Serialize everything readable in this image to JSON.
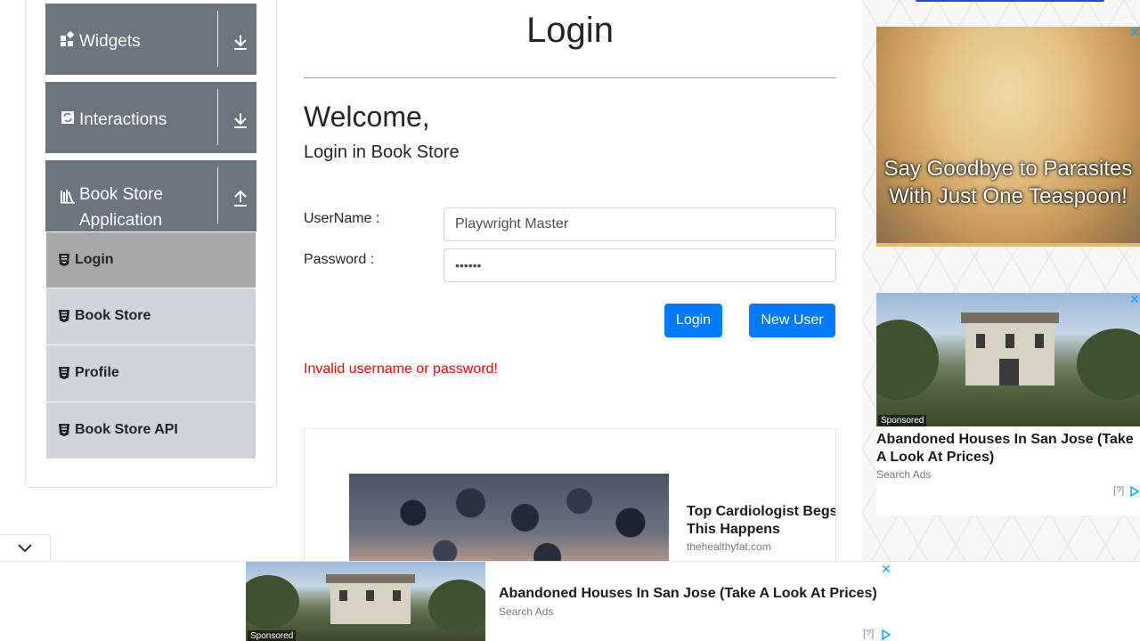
{
  "sidebar": {
    "groups": [
      {
        "label": "Widgets",
        "icon": "widgets-icon",
        "arrow": "download-arrow-icon"
      },
      {
        "label": "Interactions",
        "icon": "interactions-icon",
        "arrow": "download-arrow-icon"
      },
      {
        "label": "Book Store Application",
        "icon": "book-store-icon",
        "arrow": "upload-arrow-icon"
      }
    ],
    "items": [
      {
        "label": "Login",
        "active": true
      },
      {
        "label": "Book Store",
        "active": false
      },
      {
        "label": "Profile",
        "active": false
      },
      {
        "label": "Book Store API",
        "active": false
      }
    ]
  },
  "main": {
    "title": "Login",
    "welcome": "Welcome,",
    "subheading": "Login in Book Store",
    "username_label": "UserName :",
    "username_value": "Playwright Master",
    "password_label": "Password :",
    "password_value": "••••••",
    "login_button": "Login",
    "new_user_button": "New User",
    "error": "Invalid username or password!"
  },
  "ads": {
    "inline": {
      "title": "Top Cardiologist Begs: Quit This Happens",
      "source": "thehealthyfat.com"
    },
    "right_top": {
      "text": "Say Goodbye to Parasites With Just One Teaspoon!"
    },
    "right_card": {
      "sponsored": "Sponsored",
      "title": "Abandoned Houses In San Jose (Take A Look At Prices)",
      "source": "Search Ads",
      "help": "[?]"
    },
    "bottom": {
      "sponsored": "Sponsored",
      "title": "Abandoned Houses In San Jose (Take A Look At Prices)",
      "source": "Search Ads",
      "help": "[?]"
    }
  },
  "colors": {
    "primary": "#007bff",
    "error": "#ff0000",
    "group_header": "#6c757d",
    "menu_item": "#ced4da",
    "menu_active": "#a8a8a8"
  }
}
